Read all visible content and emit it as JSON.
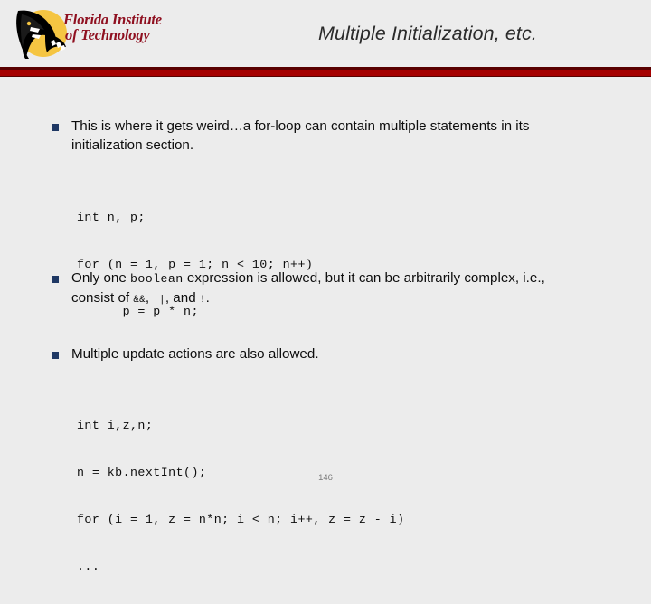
{
  "slide": {
    "title": "Multiple Initialization, etc.",
    "page_number": "146"
  },
  "logo": {
    "name": "florida-institute-of-technology",
    "line1": "Florida Institute",
    "line2": "of Technology",
    "mark_icon": "panther-head-icon",
    "wordmark_color": "#8f1020",
    "disc_color": "#f5c542",
    "panther_color": "#000000"
  },
  "header": {
    "rule_color": "#a50000",
    "rule_shadow_color": "#590000",
    "background_color": "#ececec"
  },
  "bullets": [
    {
      "marker": "square-bullet",
      "marker_color": "#1f3864",
      "segments": [
        {
          "kind": "text",
          "value": "This is where it gets weird…a for-loop can contain multiple statements in its initialization section."
        }
      ]
    },
    {
      "marker": "square-bullet",
      "marker_color": "#1f3864",
      "segments": [
        {
          "kind": "text",
          "value": "Only one "
        },
        {
          "kind": "code",
          "value": "boolean"
        },
        {
          "kind": "text",
          "value": " expression is allowed, but it can be arbitrarily complex, i.e., consist of "
        },
        {
          "kind": "op",
          "value": "&&"
        },
        {
          "kind": "text",
          "value": ", "
        },
        {
          "kind": "op",
          "value": "||"
        },
        {
          "kind": "text",
          "value": ", and "
        },
        {
          "kind": "op",
          "value": "!"
        },
        {
          "kind": "text",
          "value": "."
        }
      ]
    },
    {
      "marker": "square-bullet",
      "marker_color": "#1f3864",
      "segments": [
        {
          "kind": "text",
          "value": "Multiple update actions are also allowed."
        }
      ]
    }
  ],
  "code_blocks": [
    {
      "name": "for-loop-multiple-init-example",
      "lines": [
        "int n, p;",
        "for (n = 1, p = 1; n < 10; n++)",
        "      p = p * n;"
      ]
    },
    {
      "name": "for-loop-multiple-update-example",
      "lines": [
        "int i,z,n;",
        "n = kb.nextInt();",
        "for (i = 1, z = n*n; i < n; i++, z = z - i)",
        "..."
      ]
    }
  ]
}
